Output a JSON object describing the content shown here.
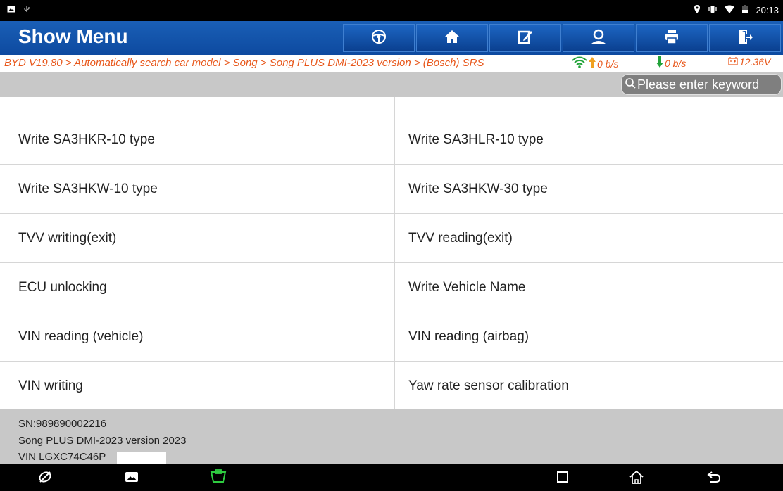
{
  "status_bar": {
    "time": "20:13"
  },
  "header": {
    "title": "Show Menu",
    "buttons": [
      {
        "name": "vehicle-button",
        "icon": "steering-wheel-icon"
      },
      {
        "name": "home-button",
        "icon": "home-icon"
      },
      {
        "name": "report-button",
        "icon": "edit-icon"
      },
      {
        "name": "support-button",
        "icon": "user-support-icon"
      },
      {
        "name": "print-button",
        "icon": "printer-icon"
      },
      {
        "name": "exit-button",
        "icon": "exit-icon"
      }
    ]
  },
  "breadcrumb": {
    "path": "BYD V19.80 > Automatically search car model > Song > Song PLUS DMI-2023 version > (Bosch) SRS",
    "upload": "0 b/s",
    "download": "0 b/s",
    "voltage": "12.36V"
  },
  "search": {
    "placeholder": "Please enter keyword"
  },
  "menu": {
    "rows": [
      [
        "Write SA3HKR-10 type",
        "Write SA3HLR-10 type"
      ],
      [
        "Write SA3HKW-10 type",
        "Write SA3HKW-30 type"
      ],
      [
        "TVV writing(exit)",
        "TVV reading(exit)"
      ],
      [
        "ECU unlocking",
        "Write Vehicle Name"
      ],
      [
        "VIN reading (vehicle)",
        "VIN reading (airbag)"
      ],
      [
        "VIN writing",
        "Yaw rate sensor calibration"
      ]
    ]
  },
  "footer": {
    "sn": "SN:989890002216",
    "model": "Song PLUS DMI-2023 version 2023",
    "vin": "VIN LGXC74C46P"
  },
  "colors": {
    "header_blue": "#1a5fb6",
    "breadcrumb_orange": "#e8581c",
    "upload_orange": "#f0a020",
    "download_green": "#22a33a",
    "gray_bar": "#c8c8c8"
  }
}
